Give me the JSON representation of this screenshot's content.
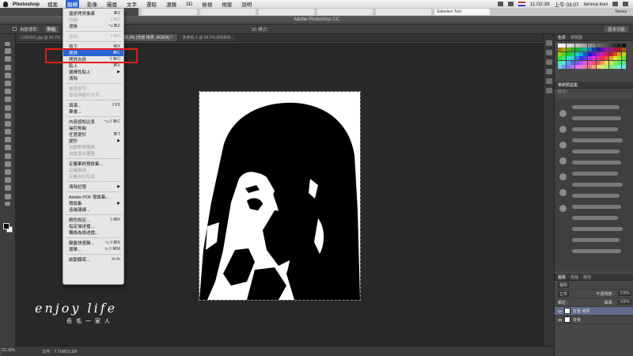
{
  "menubar": {
    "app": "Photoshop",
    "items": [
      "檔案",
      "編輯",
      "影像",
      "圖層",
      "文字",
      "選取",
      "濾鏡",
      "3D",
      "檢視",
      "視窗",
      "說明"
    ],
    "active_index": 1,
    "clock": "11:02:39",
    "clock2": "上午 03:07",
    "user": "teresa kuo"
  },
  "browser": {
    "active_tab": "Selective Tool",
    "user_chip": "Teresa"
  },
  "window_title": "Adobe Photoshop CC",
  "options_bar": {
    "auto_select": "自動選取：",
    "auto_select_value": "群組",
    "three_d_mode": "3D 模式：",
    "workspace": "基本功能"
  },
  "doc_tabs": [
    {
      "label": "LOGO01.jpg @ 66.7% ..."
    },
    {
      "label": "...150227_110445_1.jpg @ 33.3% (背景 拷貝, RGB/8) *",
      "active": true
    },
    {
      "label": "未命名-1 @ 66.7% (RGB/8)"
    }
  ],
  "edit_menu": {
    "items": [
      {
        "label": "還原拷貝像素",
        "shortcut": "⌘Z"
      },
      {
        "label": "向前",
        "shortcut": "⇧⌘Z",
        "disabled": true
      },
      {
        "label": "退後",
        "shortcut": "⌥⌘Z"
      },
      {
        "sep": true
      },
      {
        "label": "淡化...",
        "shortcut": "⇧⌘F",
        "disabled": true
      },
      {
        "sep": true
      },
      {
        "label": "剪下",
        "shortcut": "⌘X"
      },
      {
        "label": "拷貝",
        "shortcut": "⌘C",
        "highlighted": true
      },
      {
        "label": "拷貝合併",
        "shortcut": "⇧⌘C"
      },
      {
        "label": "貼上",
        "shortcut": "⌘V"
      },
      {
        "label": "選擇性貼上",
        "arrow": true
      },
      {
        "label": "清除"
      },
      {
        "sep": true
      },
      {
        "label": "檢查拼字...",
        "disabled": true
      },
      {
        "label": "尋找與替代文字...",
        "disabled": true
      },
      {
        "sep": true
      },
      {
        "label": "填滿...",
        "shortcut": "⇧F5"
      },
      {
        "label": "筆畫..."
      },
      {
        "sep": true
      },
      {
        "label": "內容感知比率",
        "shortcut": "⌥⇧⌘C"
      },
      {
        "label": "操控彎曲"
      },
      {
        "label": "任意變形",
        "shortcut": "⌘T"
      },
      {
        "label": "變形",
        "arrow": true
      },
      {
        "label": "自動對齊圖層...",
        "disabled": true
      },
      {
        "label": "自動混合圖層...",
        "disabled": true
      },
      {
        "sep": true
      },
      {
        "label": "定義筆刷預設集..."
      },
      {
        "label": "定義圖樣...",
        "disabled": true
      },
      {
        "label": "定義自訂形狀...",
        "disabled": true
      },
      {
        "sep": true
      },
      {
        "label": "清除記憶",
        "arrow": true
      },
      {
        "sep": true
      },
      {
        "label": "Adobe PDF 預設集..."
      },
      {
        "label": "預設集",
        "arrow": true
      },
      {
        "label": "遠端連線..."
      },
      {
        "sep": true
      },
      {
        "label": "顏色設定...",
        "shortcut": "⇧⌘K"
      },
      {
        "label": "指定描述檔..."
      },
      {
        "label": "轉換為描述檔..."
      },
      {
        "sep": true
      },
      {
        "label": "鍵盤快速鍵...",
        "shortcut": "⌥⇧⌘K"
      },
      {
        "label": "選單...",
        "shortcut": "⌥⇧⌘M"
      },
      {
        "sep": true
      },
      {
        "label": "啟動聽寫...",
        "shortcut": "fn fn"
      }
    ]
  },
  "panels": {
    "color_tabs": [
      "色票",
      "導覽器"
    ],
    "brush_tabs": [
      "筆刷預設集"
    ],
    "brush_size_label": "尺寸：",
    "layers_tabs": [
      "圖層",
      "色版",
      "路徑"
    ],
    "layer_kind": "種類",
    "blend_mode": "正常",
    "opacity_label": "不透明度：",
    "opacity": "100%",
    "lock_label": "鎖定：",
    "fill_label": "填滿：",
    "fill": "100%",
    "layers": [
      {
        "name": "背景 拷貝",
        "selected": true
      },
      {
        "name": "背景"
      }
    ]
  },
  "status": {
    "zoom": "33.33%",
    "doc": "文件：7.71M/15.1M"
  },
  "watermark": {
    "main": "enjoy life",
    "sub": "長毛一家人"
  },
  "colors": {
    "menu_highlight": "#2a63d4",
    "annotation_box": "#e01b1b"
  }
}
